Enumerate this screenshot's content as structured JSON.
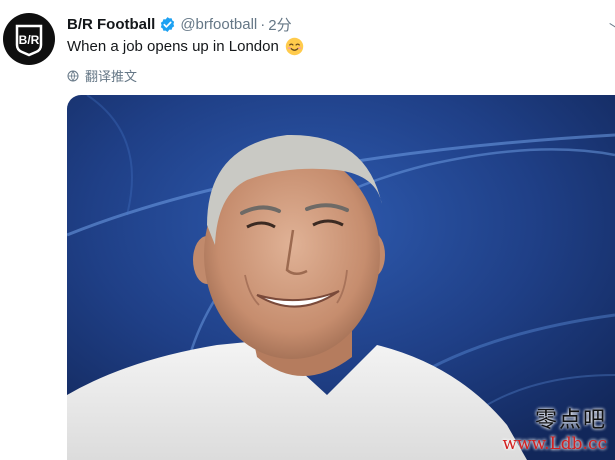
{
  "tweet": {
    "display_name": "B/R Football",
    "handle": "@brfootball",
    "separator": "·",
    "time": "2分",
    "text": "When a job opens up in London",
    "emoji_icon": "relieved-face-emoji",
    "translate_label": "翻译推文"
  },
  "avatar": {
    "logo_text": "B/R",
    "background": "#0f0f0f"
  },
  "colors": {
    "verified": "#1da1f2",
    "secondary_text": "#657786",
    "primary_text": "#14171a",
    "media_blue": "#1f3f86"
  },
  "media": {
    "description_icon": "photo-image"
  },
  "watermark": {
    "title": "零点吧",
    "url": "www.Ldb.cc"
  }
}
